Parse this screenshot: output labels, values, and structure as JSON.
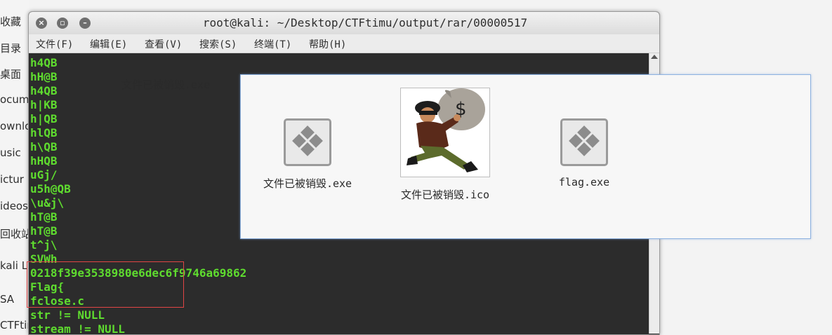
{
  "background_fm": {
    "sidebar_items": [
      "收藏",
      "目录",
      "桌面",
      "ocume",
      "ownlo",
      "usic",
      "ictur",
      "ideos",
      "回收站",
      "kali Liv",
      "SA",
      "CTFtim"
    ],
    "ghost_file_label": "文件已被销毁.exe"
  },
  "terminal": {
    "title": "root@kali: ~/Desktop/CTFtimu/output/rar/00000517",
    "menu": [
      "文件(F)",
      "编辑(E)",
      "查看(V)",
      "搜索(S)",
      "终端(T)",
      "帮助(H)"
    ],
    "lines": [
      "h4QB",
      "hH@B",
      "h4QB",
      "h|KB",
      "h|QB",
      "hlQB",
      "h\\QB",
      "hHQB",
      "uGj/",
      "u5h@QB",
      "\\u&j\\",
      "hT@B",
      "hT@B",
      "t^j\\",
      "SVWh",
      "0218f39e3538980e6dec6f9746a69862",
      "Flag{",
      "fclose.c",
      "str != NULL",
      "stream != NULL"
    ]
  },
  "file_panel": {
    "files": [
      {
        "name": "文件已被销毁.exe",
        "icon": "exe-icon"
      },
      {
        "name": "文件已被销毁.ico",
        "icon": "thief-icon"
      },
      {
        "name": "flag.exe",
        "icon": "exe-icon"
      }
    ]
  },
  "colors": {
    "terminal_text": "#5fdc2f",
    "terminal_bg": "#2c2c2c",
    "highlight": "#e14545",
    "panel_border": "#8fb3e0"
  }
}
